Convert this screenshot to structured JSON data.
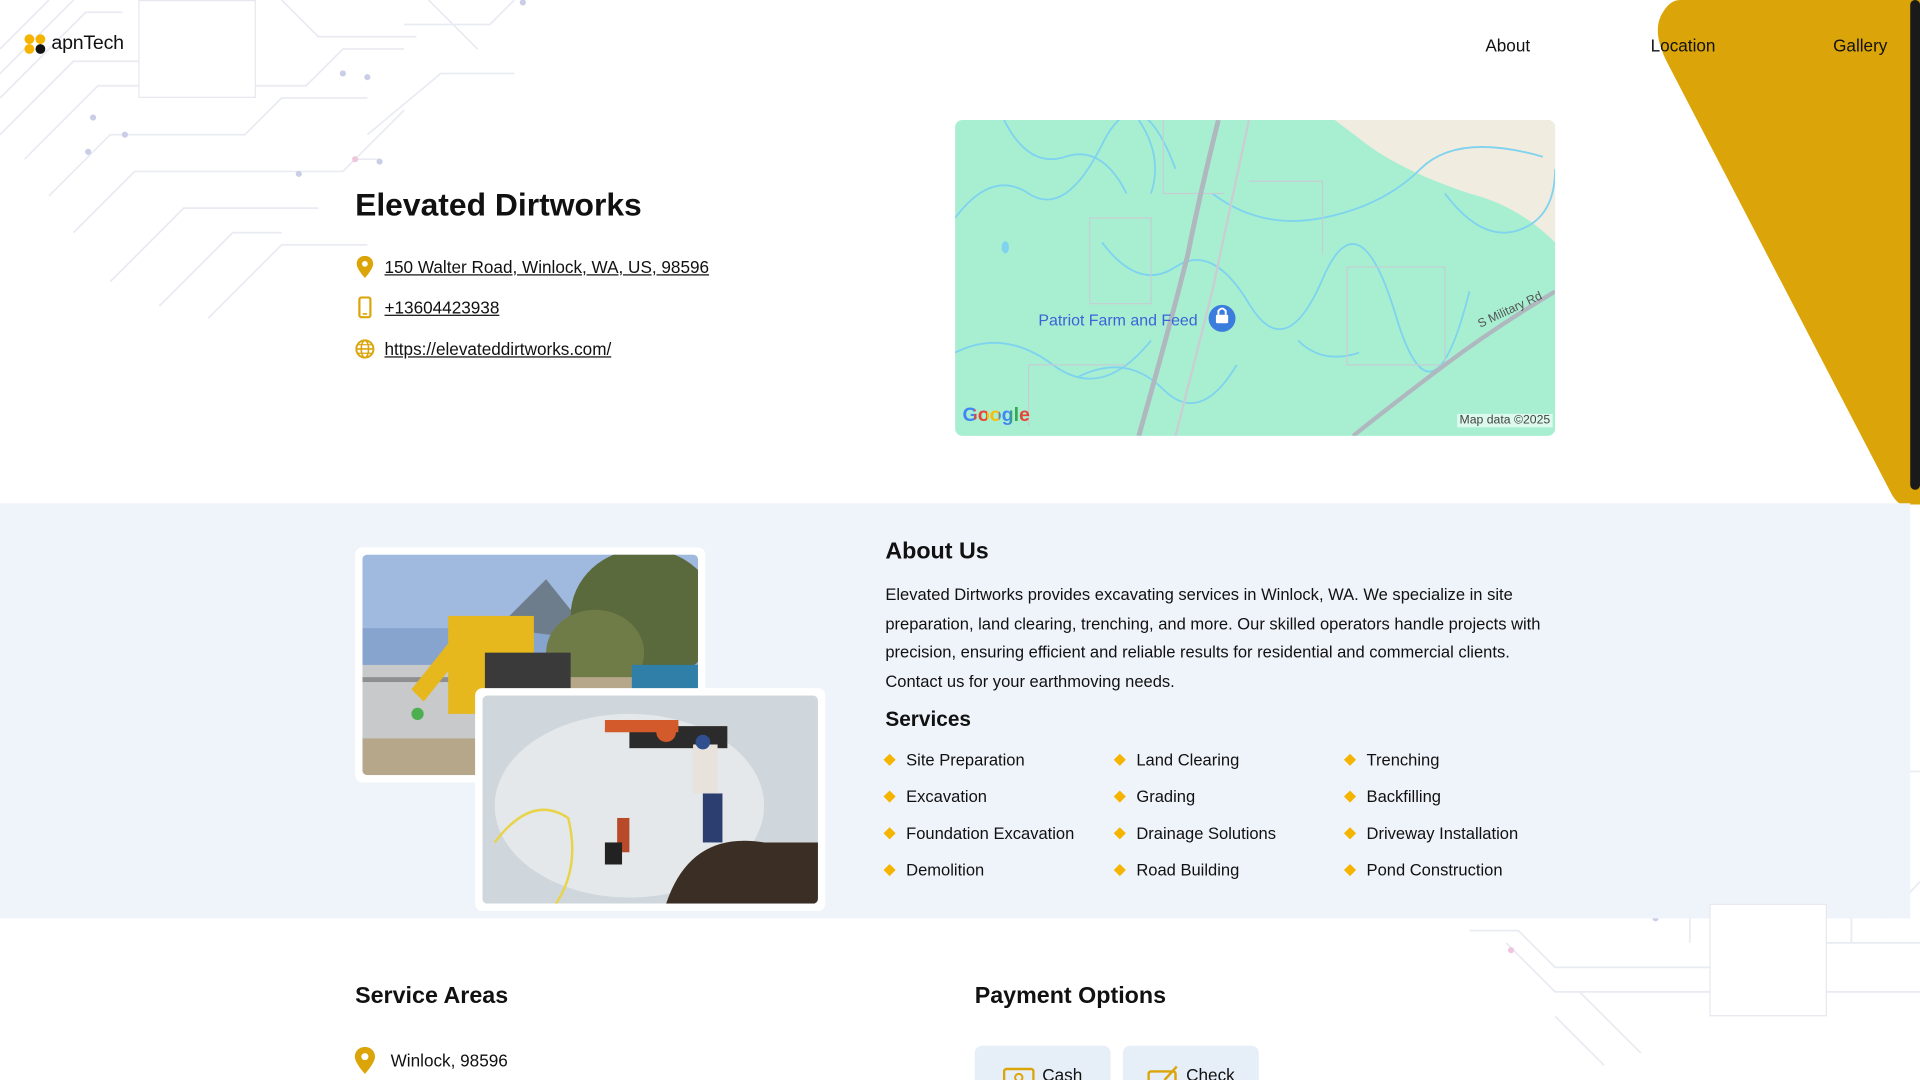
{
  "brand": {
    "name": "apnTech",
    "dot_colors": [
      "#f4b400",
      "#f4b400",
      "#111111",
      "#f4b400"
    ]
  },
  "nav": {
    "about": "About",
    "location": "Location",
    "gallery": "Gallery"
  },
  "colors": {
    "accent": "#f4b400",
    "band": "#dba50a",
    "section_bg": "#eff4fb",
    "map_green": "#a8efd2",
    "map_water": "#7fd3ee"
  },
  "business": {
    "name": "Elevated Dirtworks",
    "address": "150 Walter Road, Winlock, WA, US, 98596",
    "phone": "+13604423938",
    "website": "https://elevateddirtworks.com/"
  },
  "map": {
    "place_label": "Patriot Farm and Feed",
    "road_label": "S Military Rd",
    "provider": "Google",
    "credit": "Map data ©2025"
  },
  "about": {
    "title": "About Us",
    "text": "Elevated Dirtworks provides excavating services in Winlock, WA. We specialize in site preparation, land clearing, trenching, and more. Our skilled operators handle projects with precision, ensuring efficient and reliable results for residential and commercial clients. Contact us for your earthmoving needs.",
    "services_title": "Services",
    "services": [
      "Site Preparation",
      "Land Clearing",
      "Trenching",
      "Excavation",
      "Grading",
      "Backfilling",
      "Foundation Excavation",
      "Drainage Solutions",
      "Driveway Installation",
      "Demolition",
      "Road Building",
      "Pond Construction"
    ]
  },
  "service_areas": {
    "title": "Service Areas",
    "items": [
      "Winlock, 98596"
    ]
  },
  "payment": {
    "title": "Payment Options",
    "options": [
      "Cash",
      "Check"
    ]
  }
}
